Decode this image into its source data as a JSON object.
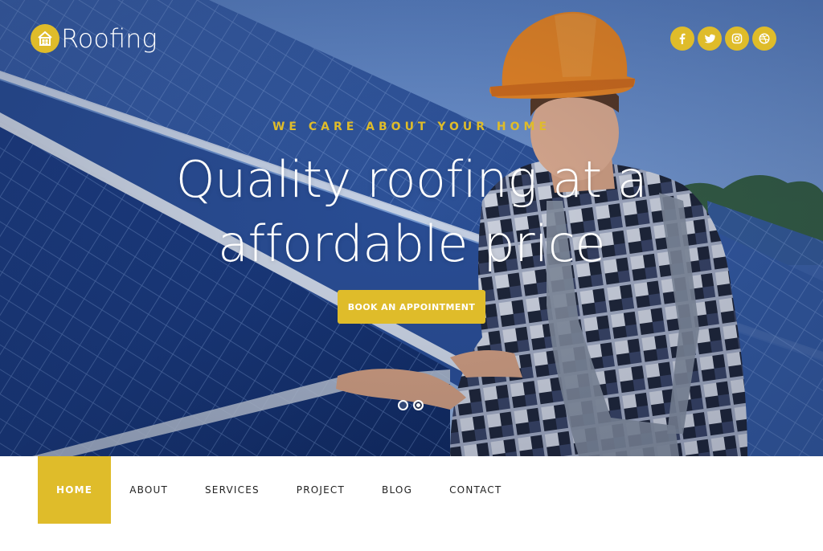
{
  "brand": {
    "name": "Roofing",
    "logo_icon": "house-icon",
    "accent_color": "#dfbc2a"
  },
  "socials": [
    {
      "icon": "facebook-icon",
      "glyph": "f"
    },
    {
      "icon": "twitter-icon",
      "glyph": "t"
    },
    {
      "icon": "instagram-icon",
      "glyph": "i"
    },
    {
      "icon": "dribbble-icon",
      "glyph": "d"
    }
  ],
  "hero": {
    "tagline": "WE CARE ABOUT YOUR HOME",
    "headline_line1": "Quality roofing at a",
    "headline_line2": "affordable price",
    "cta_label": "BOOK AN APPOINTMENT",
    "slides_count": 2,
    "active_slide": 2
  },
  "nav": {
    "items": [
      {
        "label": "HOME",
        "active": true
      },
      {
        "label": "ABOUT",
        "active": false
      },
      {
        "label": "SERVICES",
        "active": false
      },
      {
        "label": "PROJECT",
        "active": false
      },
      {
        "label": "BLOG",
        "active": false
      },
      {
        "label": "CONTACT",
        "active": false
      }
    ]
  }
}
